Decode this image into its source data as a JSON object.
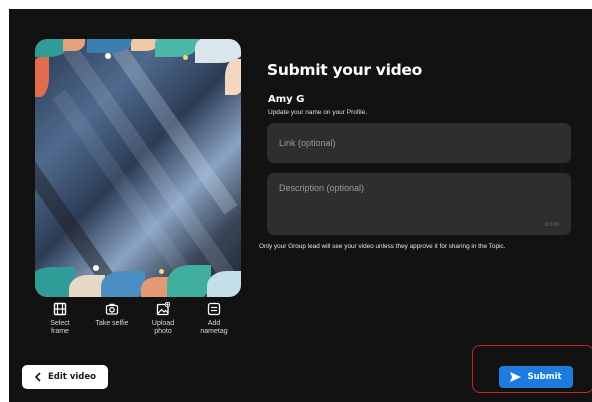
{
  "page": {
    "title": "Submit your video",
    "user_name": "Amy G",
    "profile_hint": "Update your name on your Profile."
  },
  "form": {
    "link_placeholder": "Link (optional)",
    "link_value": "",
    "description_placeholder": "Description (optional)",
    "description_value": "",
    "char_count": "0/100",
    "privacy_note": "Only your Group lead will see your video unless they approve it for sharing in the Topic."
  },
  "tools": [
    {
      "label": "Select\nframe",
      "icon": "film-icon"
    },
    {
      "label": "Take selfie",
      "icon": "camera-icon"
    },
    {
      "label": "Upload\nphoto",
      "icon": "image-add-icon"
    },
    {
      "label": "Add\nnametag",
      "icon": "nametag-icon"
    }
  ],
  "actions": {
    "edit_label": "Edit video",
    "submit_label": "Submit"
  },
  "colors": {
    "background": "#121212",
    "field": "#2e2e2e",
    "accent": "#1d7be0",
    "highlight": "#c4272b"
  }
}
